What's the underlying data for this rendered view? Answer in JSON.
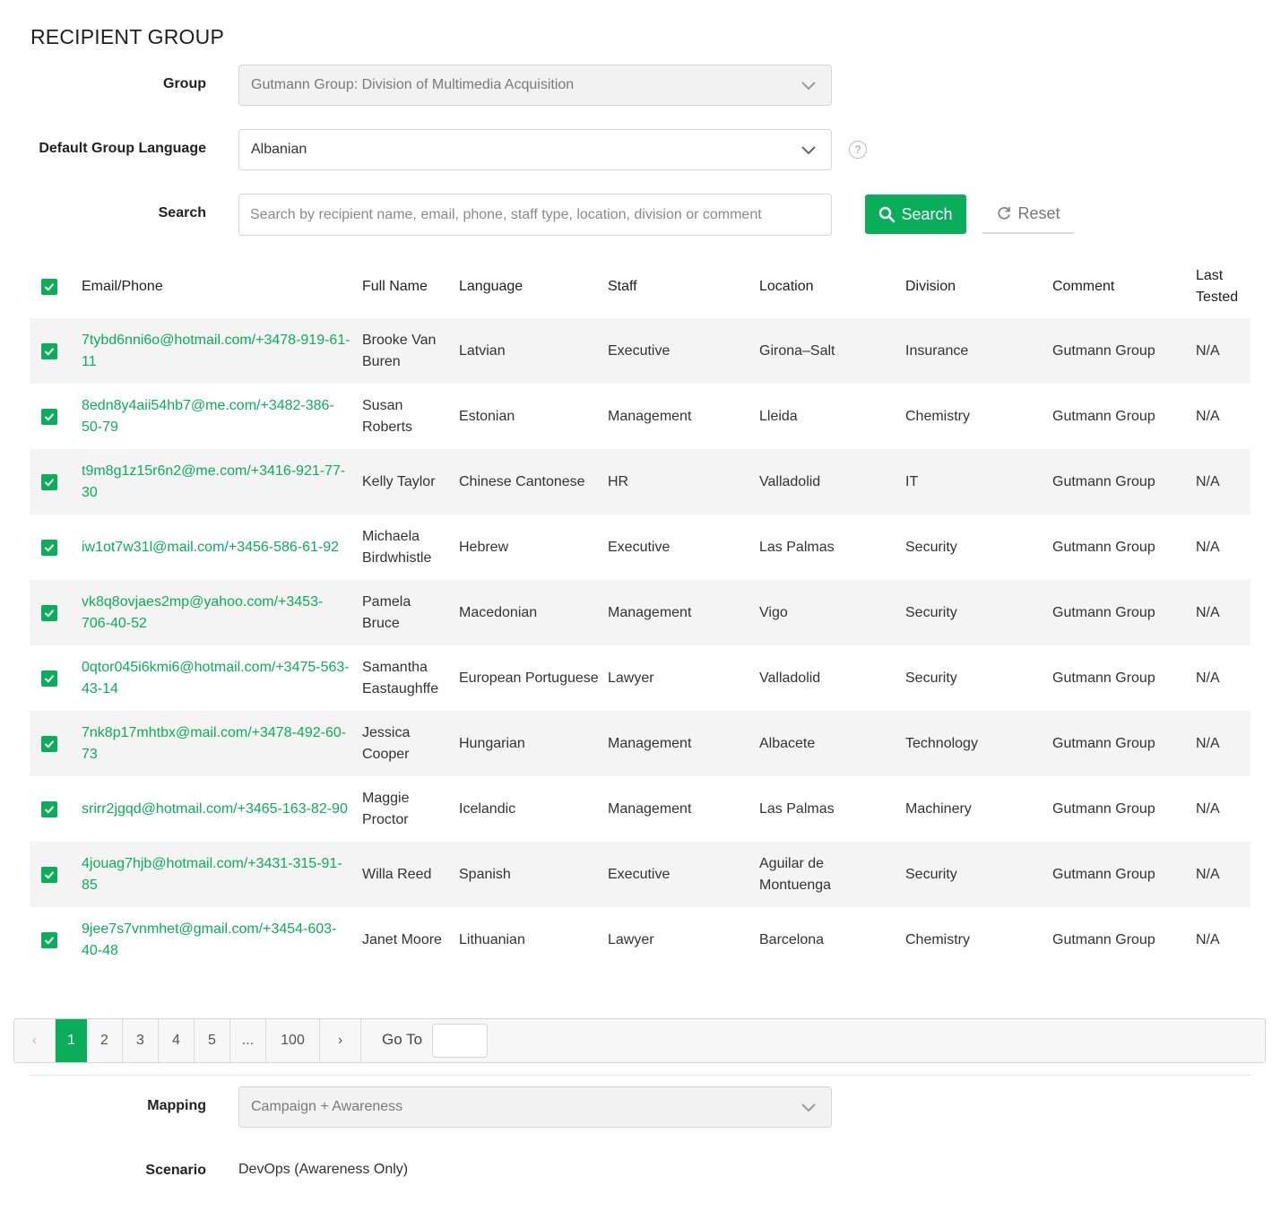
{
  "page": {
    "title": "RECIPIENT GROUP"
  },
  "form": {
    "group_label": "Group",
    "group_value": "Gutmann Group: Division of Multimedia Acquisition",
    "language_label": "Default Group Language",
    "language_value": "Albanian",
    "help_glyph": "?",
    "search_label": "Search",
    "search_placeholder": "Search by recipient name, email, phone, staff type, location, division or comment",
    "search_button": "Search",
    "reset_button": "Reset"
  },
  "table": {
    "headers": {
      "email": "Email/Phone",
      "full_name": "Full Name",
      "language": "Language",
      "staff": "Staff",
      "location": "Location",
      "division": "Division",
      "comment": "Comment",
      "last_tested": "Last Tested"
    },
    "rows": [
      {
        "email": "7tybd6nni6o@hotmail.com/+3478-919-61-11",
        "full_name": "Brooke Van Buren",
        "language": "Latvian",
        "staff": "Executive",
        "location": "Girona–Salt",
        "division": "Insurance",
        "comment": "Gutmann Group",
        "last_tested": "N/A"
      },
      {
        "email": "8edn8y4aii54hb7@me.com/+3482-386-50-79",
        "full_name": "Susan Roberts",
        "language": "Estonian",
        "staff": "Management",
        "location": "Lleida",
        "division": "Chemistry",
        "comment": "Gutmann Group",
        "last_tested": "N/A"
      },
      {
        "email": "t9m8g1z15r6n2@me.com/+3416-921-77-30",
        "full_name": "Kelly Taylor",
        "language": "Chinese Cantonese",
        "staff": "HR",
        "location": "Valladolid",
        "division": "IT",
        "comment": "Gutmann Group",
        "last_tested": "N/A"
      },
      {
        "email": "iw1ot7w31l@mail.com/+3456-586-61-92",
        "full_name": "Michaela Birdwhistle",
        "language": "Hebrew",
        "staff": "Executive",
        "location": "Las Palmas",
        "division": "Security",
        "comment": "Gutmann Group",
        "last_tested": "N/A"
      },
      {
        "email": "vk8q8ovjaes2mp@yahoo.com/+3453-706-40-52",
        "full_name": "Pamela Bruce",
        "language": "Macedonian",
        "staff": "Management",
        "location": "Vigo",
        "division": "Security",
        "comment": "Gutmann Group",
        "last_tested": "N/A"
      },
      {
        "email": "0qtor045i6kmi6@hotmail.com/+3475-563-43-14",
        "full_name": "Samantha Eastaughffe",
        "language": "European Portuguese",
        "staff": "Lawyer",
        "location": "Valladolid",
        "division": "Security",
        "comment": "Gutmann Group",
        "last_tested": "N/A"
      },
      {
        "email": "7nk8p17mhtbx@mail.com/+3478-492-60-73",
        "full_name": "Jessica Cooper",
        "language": "Hungarian",
        "staff": "Management",
        "location": "Albacete",
        "division": "Technology",
        "comment": "Gutmann Group",
        "last_tested": "N/A"
      },
      {
        "email": "srirr2jgqd@hotmail.com/+3465-163-82-90",
        "full_name": "Maggie Proctor",
        "language": "Icelandic",
        "staff": "Management",
        "location": "Las Palmas",
        "division": "Machinery",
        "comment": "Gutmann Group",
        "last_tested": "N/A"
      },
      {
        "email": "4jouag7hjb@hotmail.com/+3431-315-91-85",
        "full_name": "Willa Reed",
        "language": "Spanish",
        "staff": "Executive",
        "location": "Aguilar de Montuenga",
        "division": "Security",
        "comment": "Gutmann Group",
        "last_tested": "N/A"
      },
      {
        "email": "9jee7s7vnmhet@gmail.com/+3454-603-40-48",
        "full_name": "Janet Moore",
        "language": "Lithuanian",
        "staff": "Lawyer",
        "location": "Barcelona",
        "division": "Chemistry",
        "comment": "Gutmann Group",
        "last_tested": "N/A"
      }
    ]
  },
  "pagination": {
    "prev": "‹",
    "next": "›",
    "pages": [
      "1",
      "2",
      "3",
      "4",
      "5",
      "...",
      "100"
    ],
    "current_page": "1",
    "goto_label": "Go To"
  },
  "footer": {
    "mapping_label": "Mapping",
    "mapping_value": "Campaign + Awareness",
    "scenario_label": "Scenario",
    "scenario_value": "DevOps (Awareness Only)"
  },
  "colors": {
    "accent": "#0aae5a",
    "row_stripe": "#f4f4f4"
  },
  "icons": [
    "chevron-down-icon",
    "help-icon",
    "search-icon",
    "refresh-icon",
    "checkbox-checked-icon"
  ]
}
